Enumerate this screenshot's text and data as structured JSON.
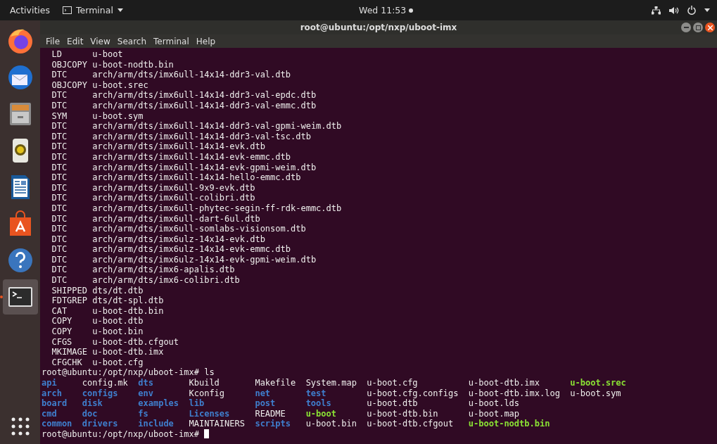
{
  "top_bar": {
    "activities": "Activities",
    "app_menu": "Terminal",
    "clock": "Wed 11:53"
  },
  "dock": {
    "items": [
      {
        "selected": false,
        "running": false
      },
      {
        "selected": false,
        "running": false
      },
      {
        "selected": false,
        "running": false
      },
      {
        "selected": false,
        "running": false
      },
      {
        "selected": false,
        "running": false
      },
      {
        "selected": false,
        "running": false
      },
      {
        "selected": false,
        "running": false
      },
      {
        "selected": true,
        "running": true
      }
    ]
  },
  "window": {
    "title": "root@ubuntu:/opt/nxp/uboot-imx",
    "menu": [
      "File",
      "Edit",
      "View",
      "Search",
      "Terminal",
      "Help"
    ]
  },
  "terminal": {
    "build_lines": [
      {
        "tag": "LD",
        "target": "u-boot"
      },
      {
        "tag": "OBJCOPY",
        "target": "u-boot-nodtb.bin"
      },
      {
        "tag": "DTC",
        "target": "arch/arm/dts/imx6ull-14x14-ddr3-val.dtb"
      },
      {
        "tag": "OBJCOPY",
        "target": "u-boot.srec"
      },
      {
        "tag": "DTC",
        "target": "arch/arm/dts/imx6ull-14x14-ddr3-val-epdc.dtb"
      },
      {
        "tag": "DTC",
        "target": "arch/arm/dts/imx6ull-14x14-ddr3-val-emmc.dtb"
      },
      {
        "tag": "SYM",
        "target": "u-boot.sym"
      },
      {
        "tag": "DTC",
        "target": "arch/arm/dts/imx6ull-14x14-ddr3-val-gpmi-weim.dtb"
      },
      {
        "tag": "DTC",
        "target": "arch/arm/dts/imx6ull-14x14-ddr3-val-tsc.dtb"
      },
      {
        "tag": "DTC",
        "target": "arch/arm/dts/imx6ull-14x14-evk.dtb"
      },
      {
        "tag": "DTC",
        "target": "arch/arm/dts/imx6ull-14x14-evk-emmc.dtb"
      },
      {
        "tag": "DTC",
        "target": "arch/arm/dts/imx6ull-14x14-evk-gpmi-weim.dtb"
      },
      {
        "tag": "DTC",
        "target": "arch/arm/dts/imx6ull-14x14-hello-emmc.dtb"
      },
      {
        "tag": "DTC",
        "target": "arch/arm/dts/imx6ull-9x9-evk.dtb"
      },
      {
        "tag": "DTC",
        "target": "arch/arm/dts/imx6ull-colibri.dtb"
      },
      {
        "tag": "DTC",
        "target": "arch/arm/dts/imx6ull-phytec-segin-ff-rdk-emmc.dtb"
      },
      {
        "tag": "DTC",
        "target": "arch/arm/dts/imx6ull-dart-6ul.dtb"
      },
      {
        "tag": "DTC",
        "target": "arch/arm/dts/imx6ull-somlabs-visionsom.dtb"
      },
      {
        "tag": "DTC",
        "target": "arch/arm/dts/imx6ulz-14x14-evk.dtb"
      },
      {
        "tag": "DTC",
        "target": "arch/arm/dts/imx6ulz-14x14-evk-emmc.dtb"
      },
      {
        "tag": "DTC",
        "target": "arch/arm/dts/imx6ulz-14x14-evk-gpmi-weim.dtb"
      },
      {
        "tag": "DTC",
        "target": "arch/arm/dts/imx6-apalis.dtb"
      },
      {
        "tag": "DTC",
        "target": "arch/arm/dts/imx6-colibri.dtb"
      },
      {
        "tag": "SHIPPED",
        "target": "dts/dt.dtb"
      },
      {
        "tag": "FDTGREP",
        "target": "dts/dt-spl.dtb"
      },
      {
        "tag": "CAT",
        "target": "u-boot-dtb.bin"
      },
      {
        "tag": "COPY",
        "target": "u-boot.dtb"
      },
      {
        "tag": "COPY",
        "target": "u-boot.bin"
      },
      {
        "tag": "CFGS",
        "target": "u-boot-dtb.cfgout"
      },
      {
        "tag": "MKIMAGE",
        "target": "u-boot-dtb.imx"
      },
      {
        "tag": "CFGCHK",
        "target": "u-boot.cfg"
      }
    ],
    "prompt": "root@ubuntu:/opt/nxp/uboot-imx#",
    "command": "ls",
    "ls_columns": [
      [
        {
          "name": "api",
          "kind": "dir"
        },
        {
          "name": "arch",
          "kind": "dir"
        },
        {
          "name": "board",
          "kind": "dir"
        },
        {
          "name": "cmd",
          "kind": "dir"
        },
        {
          "name": "common",
          "kind": "dir"
        }
      ],
      [
        {
          "name": "config.mk",
          "kind": "file"
        },
        {
          "name": "configs",
          "kind": "dir"
        },
        {
          "name": "disk",
          "kind": "dir"
        },
        {
          "name": "doc",
          "kind": "dir"
        },
        {
          "name": "drivers",
          "kind": "dir"
        }
      ],
      [
        {
          "name": "dts",
          "kind": "dir"
        },
        {
          "name": "env",
          "kind": "dir"
        },
        {
          "name": "examples",
          "kind": "dir"
        },
        {
          "name": "fs",
          "kind": "dir"
        },
        {
          "name": "include",
          "kind": "dir"
        }
      ],
      [
        {
          "name": "Kbuild",
          "kind": "file"
        },
        {
          "name": "Kconfig",
          "kind": "file"
        },
        {
          "name": "lib",
          "kind": "dir"
        },
        {
          "name": "Licenses",
          "kind": "dir"
        },
        {
          "name": "MAINTAINERS",
          "kind": "file"
        }
      ],
      [
        {
          "name": "Makefile",
          "kind": "file"
        },
        {
          "name": "net",
          "kind": "dir"
        },
        {
          "name": "post",
          "kind": "dir"
        },
        {
          "name": "README",
          "kind": "file"
        },
        {
          "name": "scripts",
          "kind": "dir"
        }
      ],
      [
        {
          "name": "System.map",
          "kind": "file"
        },
        {
          "name": "test",
          "kind": "dir"
        },
        {
          "name": "tools",
          "kind": "dir"
        },
        {
          "name": "u-boot",
          "kind": "exec"
        },
        {
          "name": "u-boot.bin",
          "kind": "file"
        }
      ],
      [
        {
          "name": "u-boot.cfg",
          "kind": "file"
        },
        {
          "name": "u-boot.cfg.configs",
          "kind": "file"
        },
        {
          "name": "u-boot.dtb",
          "kind": "file"
        },
        {
          "name": "u-boot-dtb.bin",
          "kind": "file"
        },
        {
          "name": "u-boot-dtb.cfgout",
          "kind": "file"
        }
      ],
      [
        {
          "name": "u-boot-dtb.imx",
          "kind": "file"
        },
        {
          "name": "u-boot-dtb.imx.log",
          "kind": "file"
        },
        {
          "name": "u-boot.lds",
          "kind": "file"
        },
        {
          "name": "u-boot.map",
          "kind": "file"
        },
        {
          "name": "u-boot-nodtb.bin",
          "kind": "exec"
        }
      ],
      [
        {
          "name": "u-boot.srec",
          "kind": "exec"
        },
        {
          "name": "u-boot.sym",
          "kind": "file"
        }
      ]
    ],
    "final_prompt": "root@ubuntu:/opt/nxp/uboot-imx#"
  }
}
